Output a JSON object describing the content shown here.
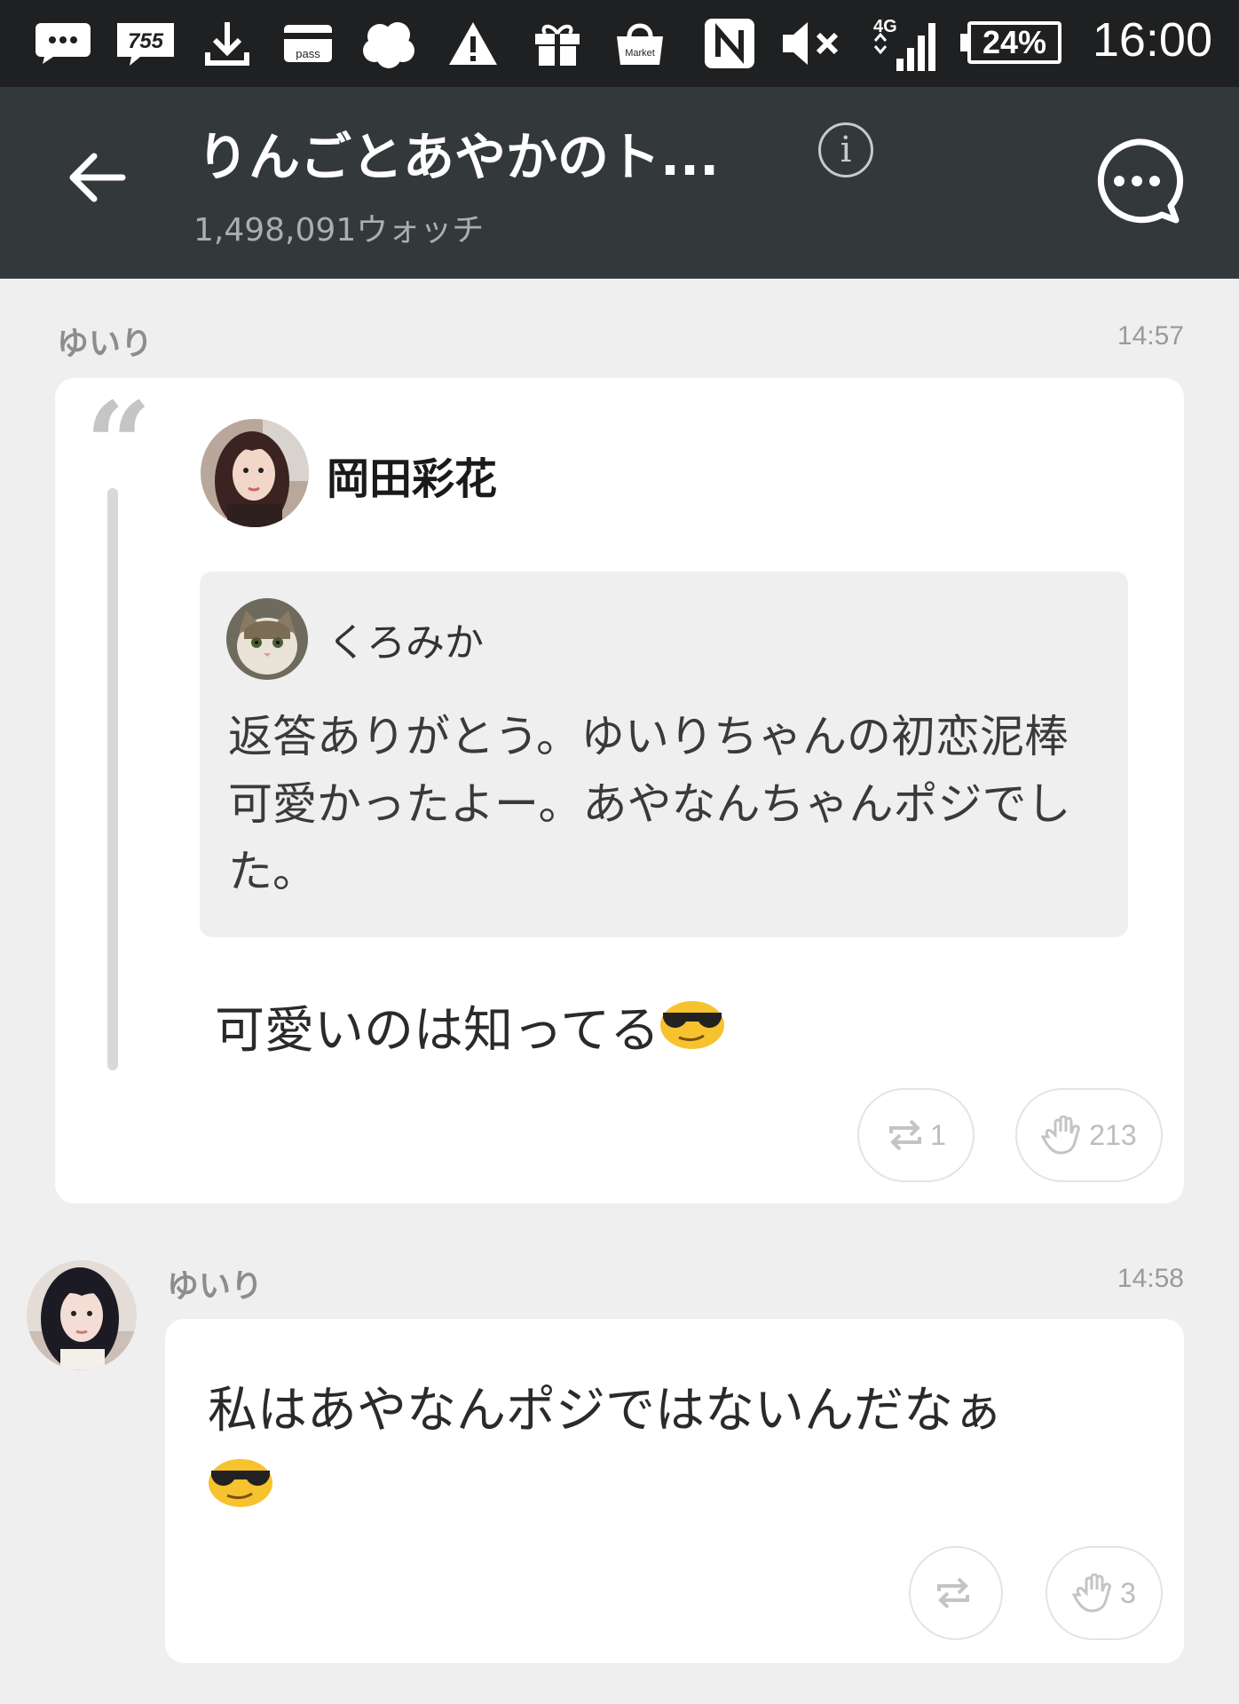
{
  "status_bar": {
    "time": "16:00",
    "battery": "24%",
    "network": "4G",
    "icons": [
      "chat-bubble-icon",
      "app-755-icon",
      "download-icon",
      "pass-card-icon",
      "cloud-app-icon",
      "warning-icon",
      "gift-icon",
      "market-bag-icon",
      "nfc-icon",
      "mute-icon",
      "signal-icon",
      "battery-icon"
    ],
    "app_labels": {
      "app755": "755",
      "pass": "pass",
      "market": "Market"
    }
  },
  "header": {
    "title": "りんごとあやかのト...",
    "watch_count": "1,498,091ウォッチ",
    "info": "i",
    "bg_color": "#33393a"
  },
  "messages": [
    {
      "sender": "ゆいり",
      "time": "14:57",
      "author": "岡田彩花",
      "quoted": {
        "name": "くろみか",
        "text": "返答ありがとう。ゆいりちゃんの初恋泥棒可愛かったよー。あやなんちゃんポジでした。"
      },
      "text": "可愛いのは知ってる",
      "emoji": "sunglasses-face",
      "repost_count": "1",
      "clap_count": "213"
    },
    {
      "sender": "ゆいり",
      "time": "14:58",
      "text": "私はあやなんポジではないんだなぁ",
      "emoji": "sunglasses-face",
      "repost_count": "",
      "clap_count": "3"
    }
  ]
}
